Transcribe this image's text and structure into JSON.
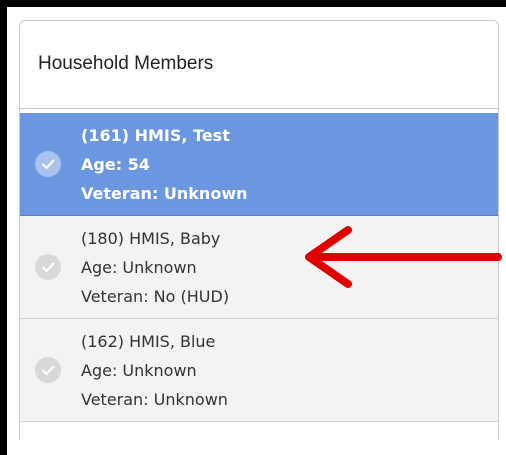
{
  "panel": {
    "title": "Household Members"
  },
  "members": [
    {
      "name": "(161) HMIS, Test",
      "age": "Age: 54",
      "veteran": "Veteran: Unknown",
      "selected": true
    },
    {
      "name": "(180) HMIS, Baby",
      "age": "Age: Unknown",
      "veteran": "Veteran: No (HUD)",
      "selected": false
    },
    {
      "name": "(162) HMIS, Blue",
      "age": "Age: Unknown",
      "veteran": "Veteran: Unknown",
      "selected": false
    }
  ],
  "colors": {
    "selected_row": "#6b97e0",
    "row": "#f3f3f3",
    "annotation_arrow": "#e00000"
  },
  "icons": {
    "member_status": "check-circle-icon",
    "annotation": "arrow-left-icon"
  }
}
